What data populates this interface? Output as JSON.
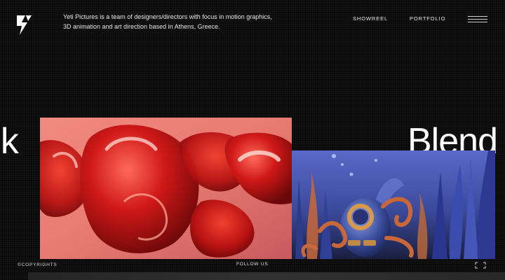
{
  "header": {
    "intro_text": "Yeti Pictures is a team of designers/directors with focus in motion graphics, 3D animation and art direction based in Athens, Greece.",
    "nav": [
      {
        "label": "SHOWREEL"
      },
      {
        "label": "PORTFOLIO"
      }
    ],
    "logo_icon": "lightning-bolt-logo-icon",
    "menu_icon": "hamburger-menu-icon"
  },
  "marquee": {
    "left_text": "rik",
    "right_text": "Blend"
  },
  "gallery": [
    {
      "name": "red-glossy-gummy-shapes-artwork",
      "dominant_color": "#c81c1c"
    },
    {
      "name": "underwater-diver-octopus-scene-artwork",
      "dominant_color": "#3b4fa0"
    }
  ],
  "footer": {
    "copyright": "©COPYRIGHTS",
    "follow": "FOLLOW US",
    "fullscreen_icon": "fullscreen-icon"
  },
  "colors": {
    "background": "#0b0b0b",
    "text": "#ffffff"
  }
}
